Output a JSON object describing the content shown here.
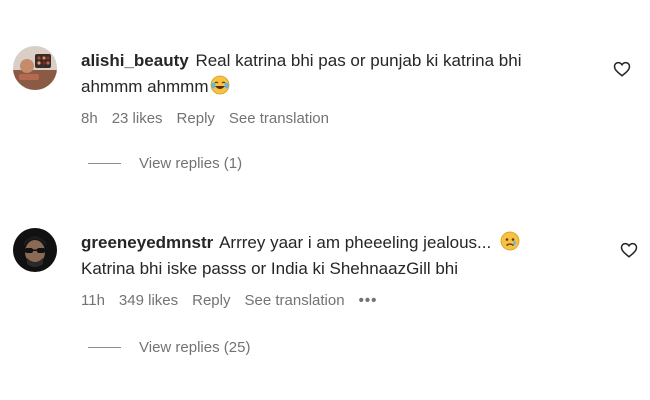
{
  "comments": [
    {
      "username": "alishi_beauty",
      "text_line1": "Real katrina bhi pas or punjab ki katrina bhi",
      "text_line2": "ahmmm ahmmm",
      "emoji_icon": "laughing-tears-emoji",
      "time": "8h",
      "likes": "23 likes",
      "reply_label": "Reply",
      "translation_label": "See translation",
      "view_replies": "View replies (1)"
    },
    {
      "username": "greeneyedmnstr",
      "text_line1": "Arrrey yaar i am pheeeling jealous...",
      "text_line2": "Katrina bhi iske passs or India ki ShehnaazGill bhi",
      "emoji_icon": "sad-face-emoji",
      "time": "11h",
      "likes": "349 likes",
      "reply_label": "Reply",
      "translation_label": "See translation",
      "more_label": "•••",
      "view_replies": "View replies (25)"
    }
  ],
  "colors": {
    "text": "#262626",
    "muted": "#737373"
  }
}
